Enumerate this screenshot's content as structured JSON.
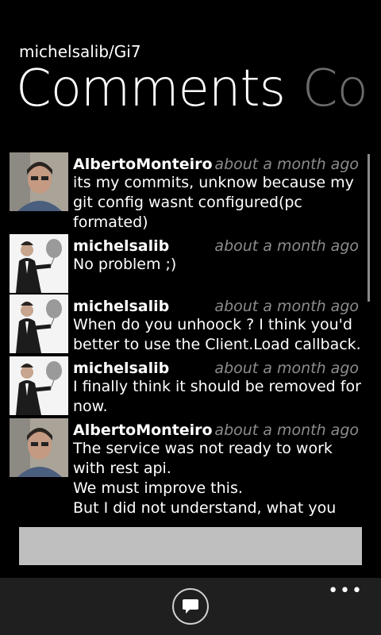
{
  "app_title": "michelsalib/Gi7",
  "pivot": {
    "active": "Comments",
    "next": "Co"
  },
  "comments": [
    {
      "author": "AlbertoMonteiro",
      "time": "about a month ago",
      "body": "its my commits, unknow because my git config wasnt configured(pc formated)"
    },
    {
      "author": "michelsalib",
      "time": "about a month ago",
      "body": "No problem ;)"
    },
    {
      "author": "michelsalib",
      "time": "about a month ago",
      "body": "When do you unhoock ? I think you'd better to use the Client.Load callback."
    },
    {
      "author": "michelsalib",
      "time": "about a month ago",
      "body": "I finally think it should be removed for now."
    },
    {
      "author": "AlbertoMonteiro",
      "time": "about a month ago",
      "body": "The service was not ready to work with rest api.\nWe must improve this.\nBut I did not understand, what you want to remove? Just this line of"
    }
  ],
  "appbar": {
    "ellipsis": "•••",
    "comment_icon": "comment-icon"
  }
}
